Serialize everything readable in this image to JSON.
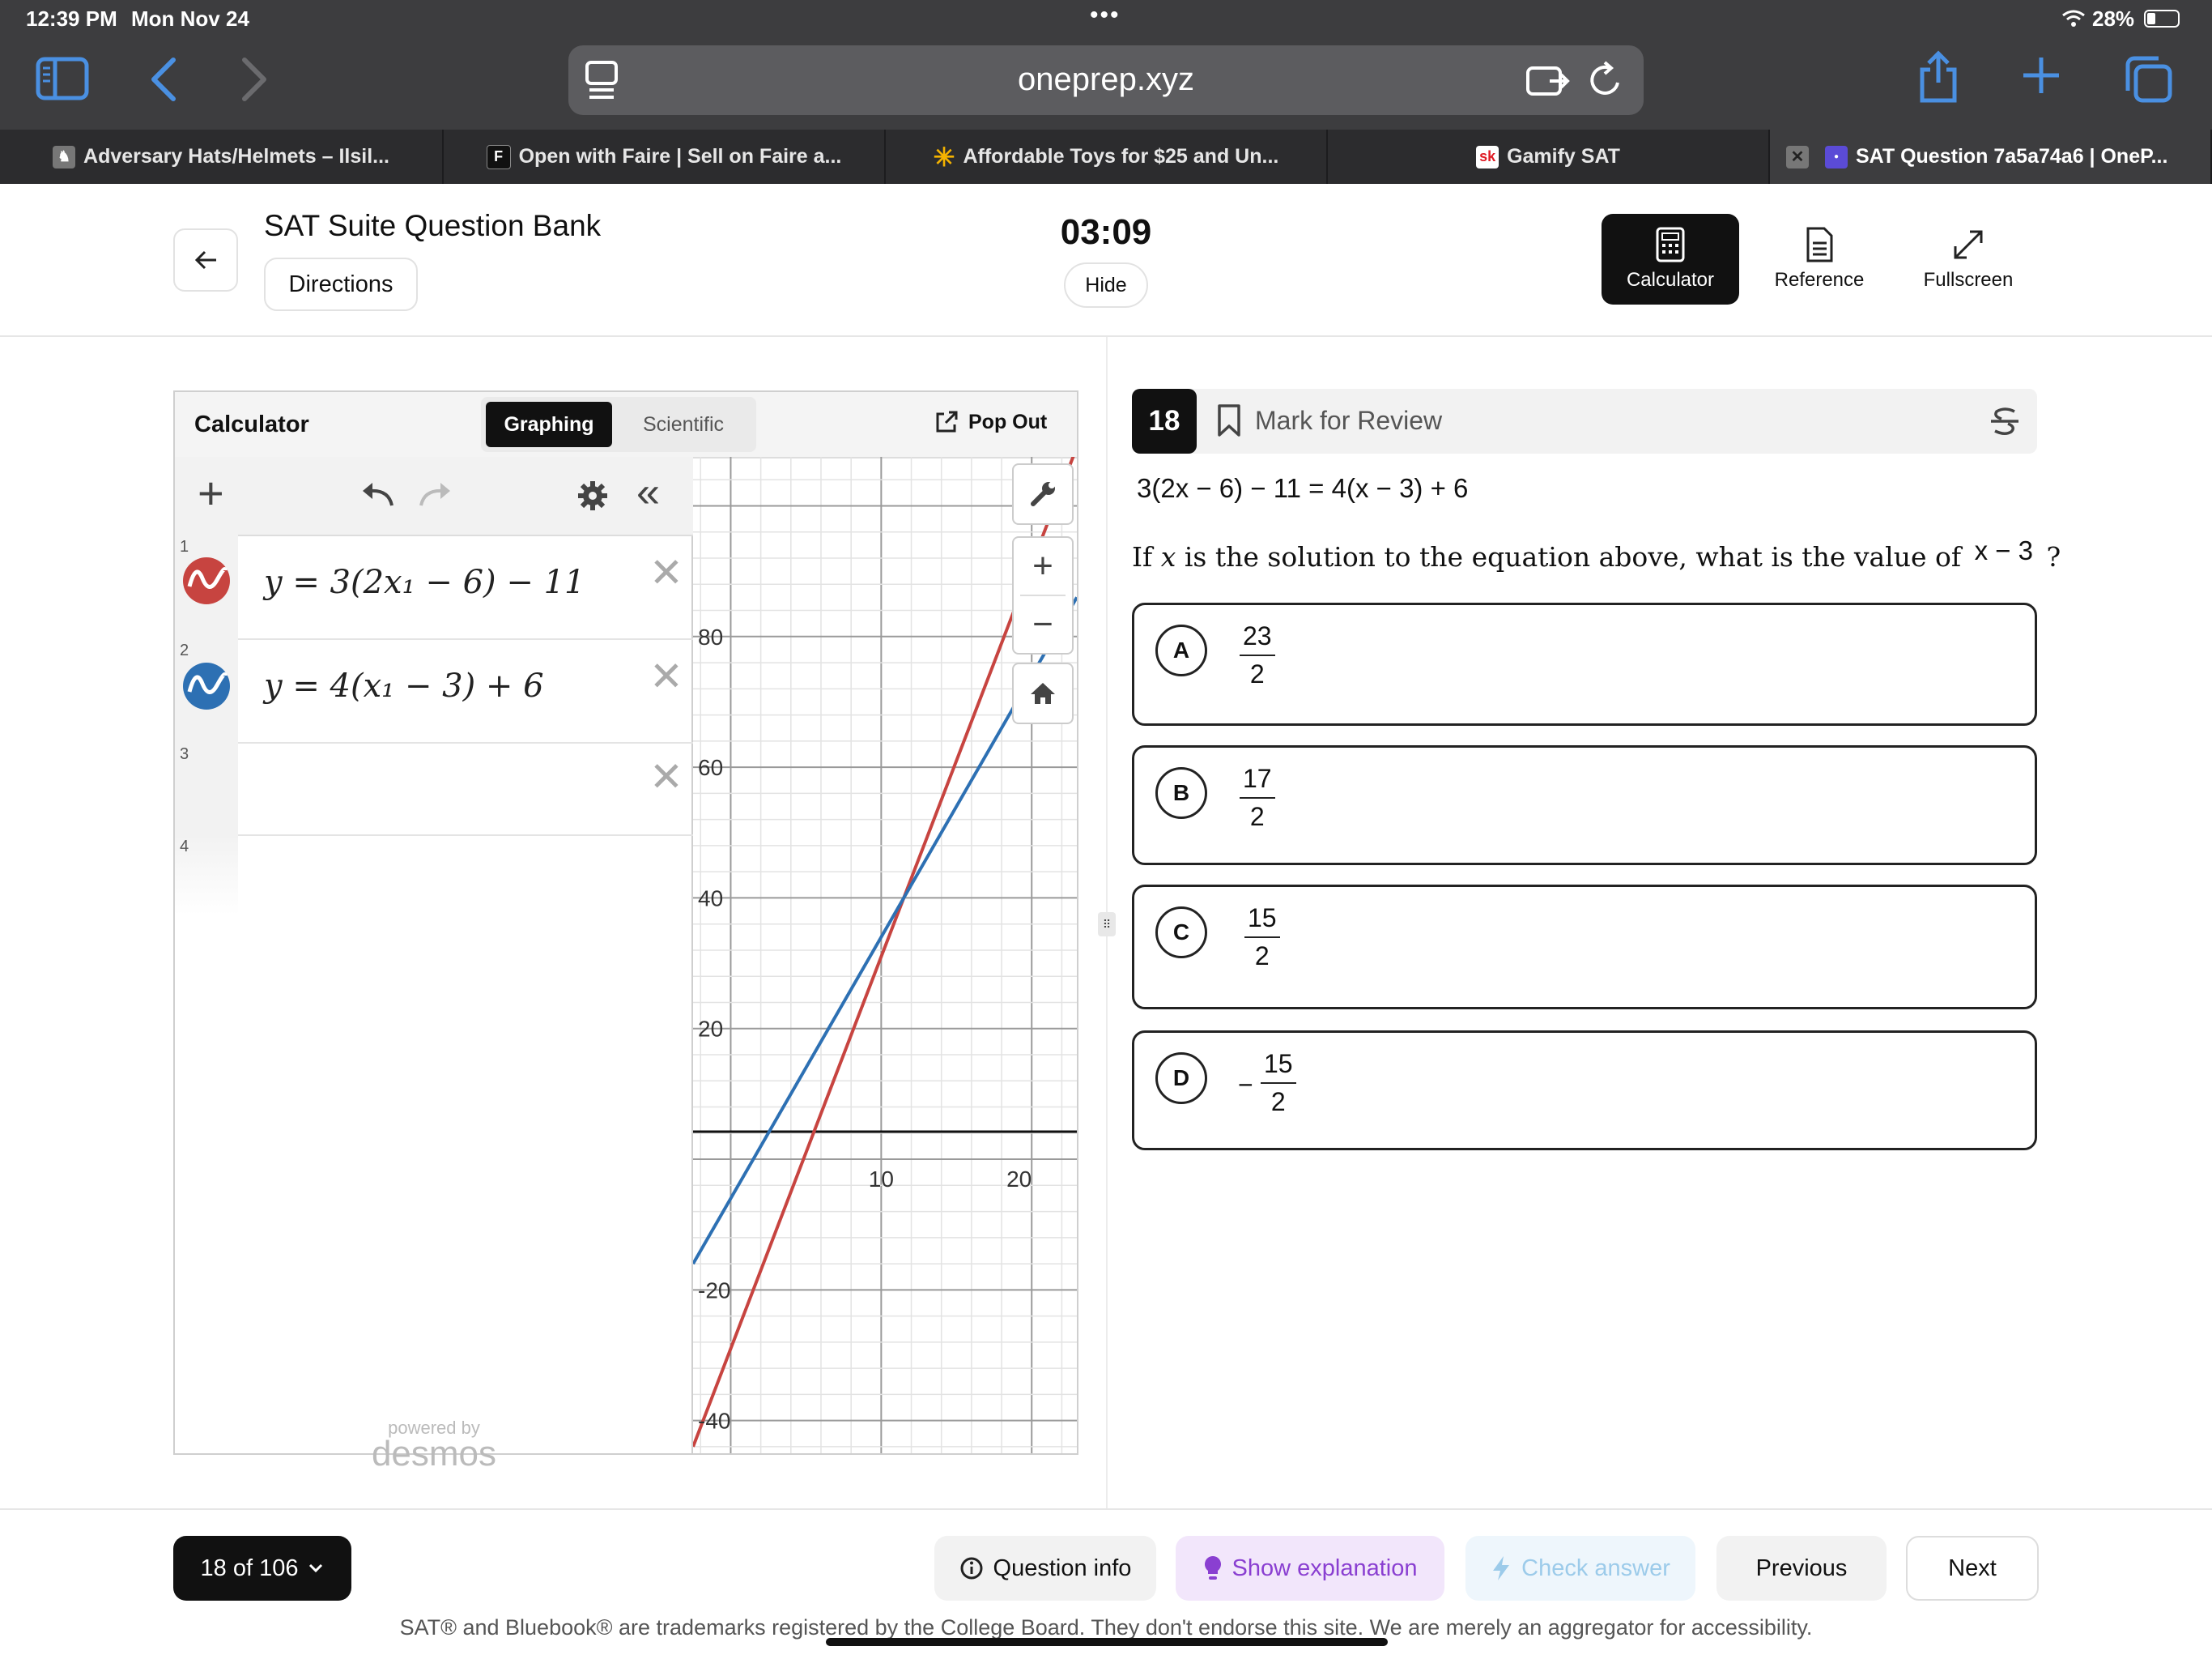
{
  "status": {
    "time": "12:39 PM",
    "date": "Mon Nov 24",
    "battery": "28%"
  },
  "browser": {
    "url": "oneprep.xyz"
  },
  "tabs": [
    {
      "label": "Adversary Hats/Helmets – Ilsil..."
    },
    {
      "label": "Open with Faire | Sell on Faire a...",
      "favicon": "F"
    },
    {
      "label": "Affordable Toys for $25 and Un..."
    },
    {
      "label": "Gamify SAT",
      "favicon": "sk"
    },
    {
      "label": "SAT Question 7a5a74a6 | OneP..."
    }
  ],
  "header": {
    "title": "SAT Suite Question Bank",
    "directions": "Directions",
    "timer": "03:09",
    "hide": "Hide",
    "tools": {
      "calculator": "Calculator",
      "reference": "Reference",
      "fullscreen": "Fullscreen"
    }
  },
  "calculator": {
    "title": "Calculator",
    "tab_graphing": "Graphing",
    "tab_scientific": "Scientific",
    "popout": "Pop Out",
    "expressions": [
      {
        "num": "1",
        "text": "y = 3(2x₁ − 6) − 11",
        "color": "#c74440"
      },
      {
        "num": "2",
        "text": "y = 4(x₁ − 3) + 6",
        "color": "#2d70b3"
      },
      {
        "num": "3",
        "text": ""
      },
      {
        "num": "4",
        "text": ""
      }
    ],
    "powered_by": "powered by",
    "brand": "desmos",
    "graph": {
      "x_ticks": [
        "10",
        "20"
      ],
      "y_ticks": [
        "80",
        "60",
        "40",
        "20",
        "-20",
        "-40"
      ]
    }
  },
  "question": {
    "number": "18",
    "mark_review": "Mark for Review",
    "equation": "3(2x − 6) − 11 = 4(x − 3) + 6",
    "prompt_before": "If",
    "prompt_var": "x",
    "prompt_after": "is the solution to the equation above, what is the value of",
    "prompt_expr": "x − 3",
    "prompt_end": "?",
    "choices": [
      {
        "letter": "A",
        "num": "23",
        "den": "2",
        "sign": ""
      },
      {
        "letter": "B",
        "num": "17",
        "den": "2",
        "sign": ""
      },
      {
        "letter": "C",
        "num": "15",
        "den": "2",
        "sign": ""
      },
      {
        "letter": "D",
        "num": "15",
        "den": "2",
        "sign": "−"
      }
    ]
  },
  "footer": {
    "progress": "18 of 106",
    "question_info": "Question info",
    "show_explanation": "Show explanation",
    "check_answer": "Check answer",
    "previous": "Previous",
    "next": "Next",
    "disclaimer": "SAT® and Bluebook® are trademarks registered by the College Board. They don't endorse this site. We are merely an aggregator for accessibility."
  }
}
